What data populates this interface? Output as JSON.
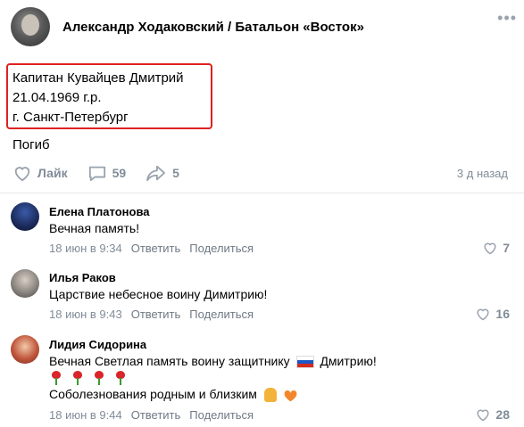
{
  "post": {
    "author": "Александр Ходаковский / Батальон «Восток»",
    "lines": [
      "Капитан Кувайцев Дмитрий",
      "21.04.1969 г.р.",
      "г. Санкт-Петербург"
    ],
    "status": "Погиб",
    "time_ago": "3 д назад"
  },
  "actions": {
    "like_label": "Лайк",
    "comments_count": "59",
    "shares_count": "5"
  },
  "comments": [
    {
      "name": "Елена Платонова",
      "text": "Вечная память!",
      "time": "18 июн в 9:34",
      "reply": "Ответить",
      "share": "Поделиться",
      "likes": "7"
    },
    {
      "name": "Илья Раков",
      "text": "Царствие небесное воину Димитрию!",
      "time": "18 июн в 9:43",
      "reply": "Ответить",
      "share": "Поделиться",
      "likes": "16"
    },
    {
      "name": "Лидия Сидорина",
      "text_part1": "Вечная Светлая память воину защитнику",
      "text_part2": "Дмитрию!",
      "text_line3": "Соболезнования родным и близким",
      "time": "18 июн в 9:44",
      "reply": "Ответить",
      "share": "Поделиться",
      "likes": "28"
    }
  ],
  "colors": {
    "accent_grey": "#818c99",
    "highlight_border": "#e02020",
    "divider": "#e7e8ec"
  },
  "icons": [
    "more-dots-icon",
    "heart-outline-icon",
    "comment-bubble-icon",
    "share-arrow-icon",
    "rose-emoji-icon",
    "russian-flag-emoji-icon",
    "praying-hands-emoji-icon",
    "orange-heart-emoji-icon"
  ]
}
